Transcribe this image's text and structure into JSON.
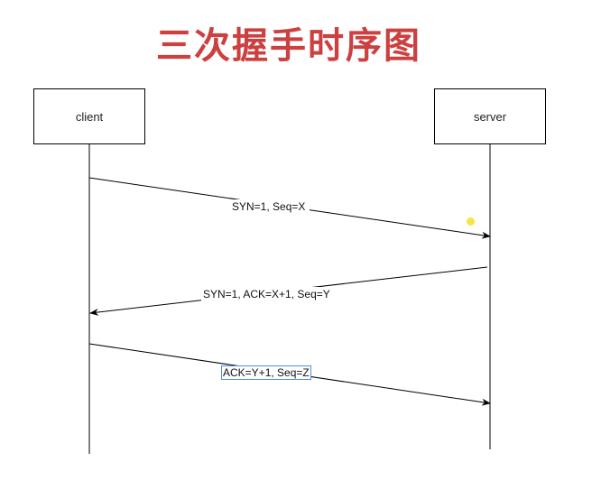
{
  "title": "三次握手时序图",
  "colors": {
    "title": "#cc4040",
    "line": "#000000",
    "selection": "#4a90e2",
    "cursor": "#f5e642"
  },
  "actors": {
    "client": "client",
    "server": "server"
  },
  "messages": [
    {
      "from": "client",
      "to": "server",
      "label": "SYN=1, Seq=X"
    },
    {
      "from": "server",
      "to": "client",
      "label": "SYN=1, ACK=X+1, Seq=Y"
    },
    {
      "from": "client",
      "to": "server",
      "label": "ACK=Y+1, Seq=Z"
    }
  ]
}
